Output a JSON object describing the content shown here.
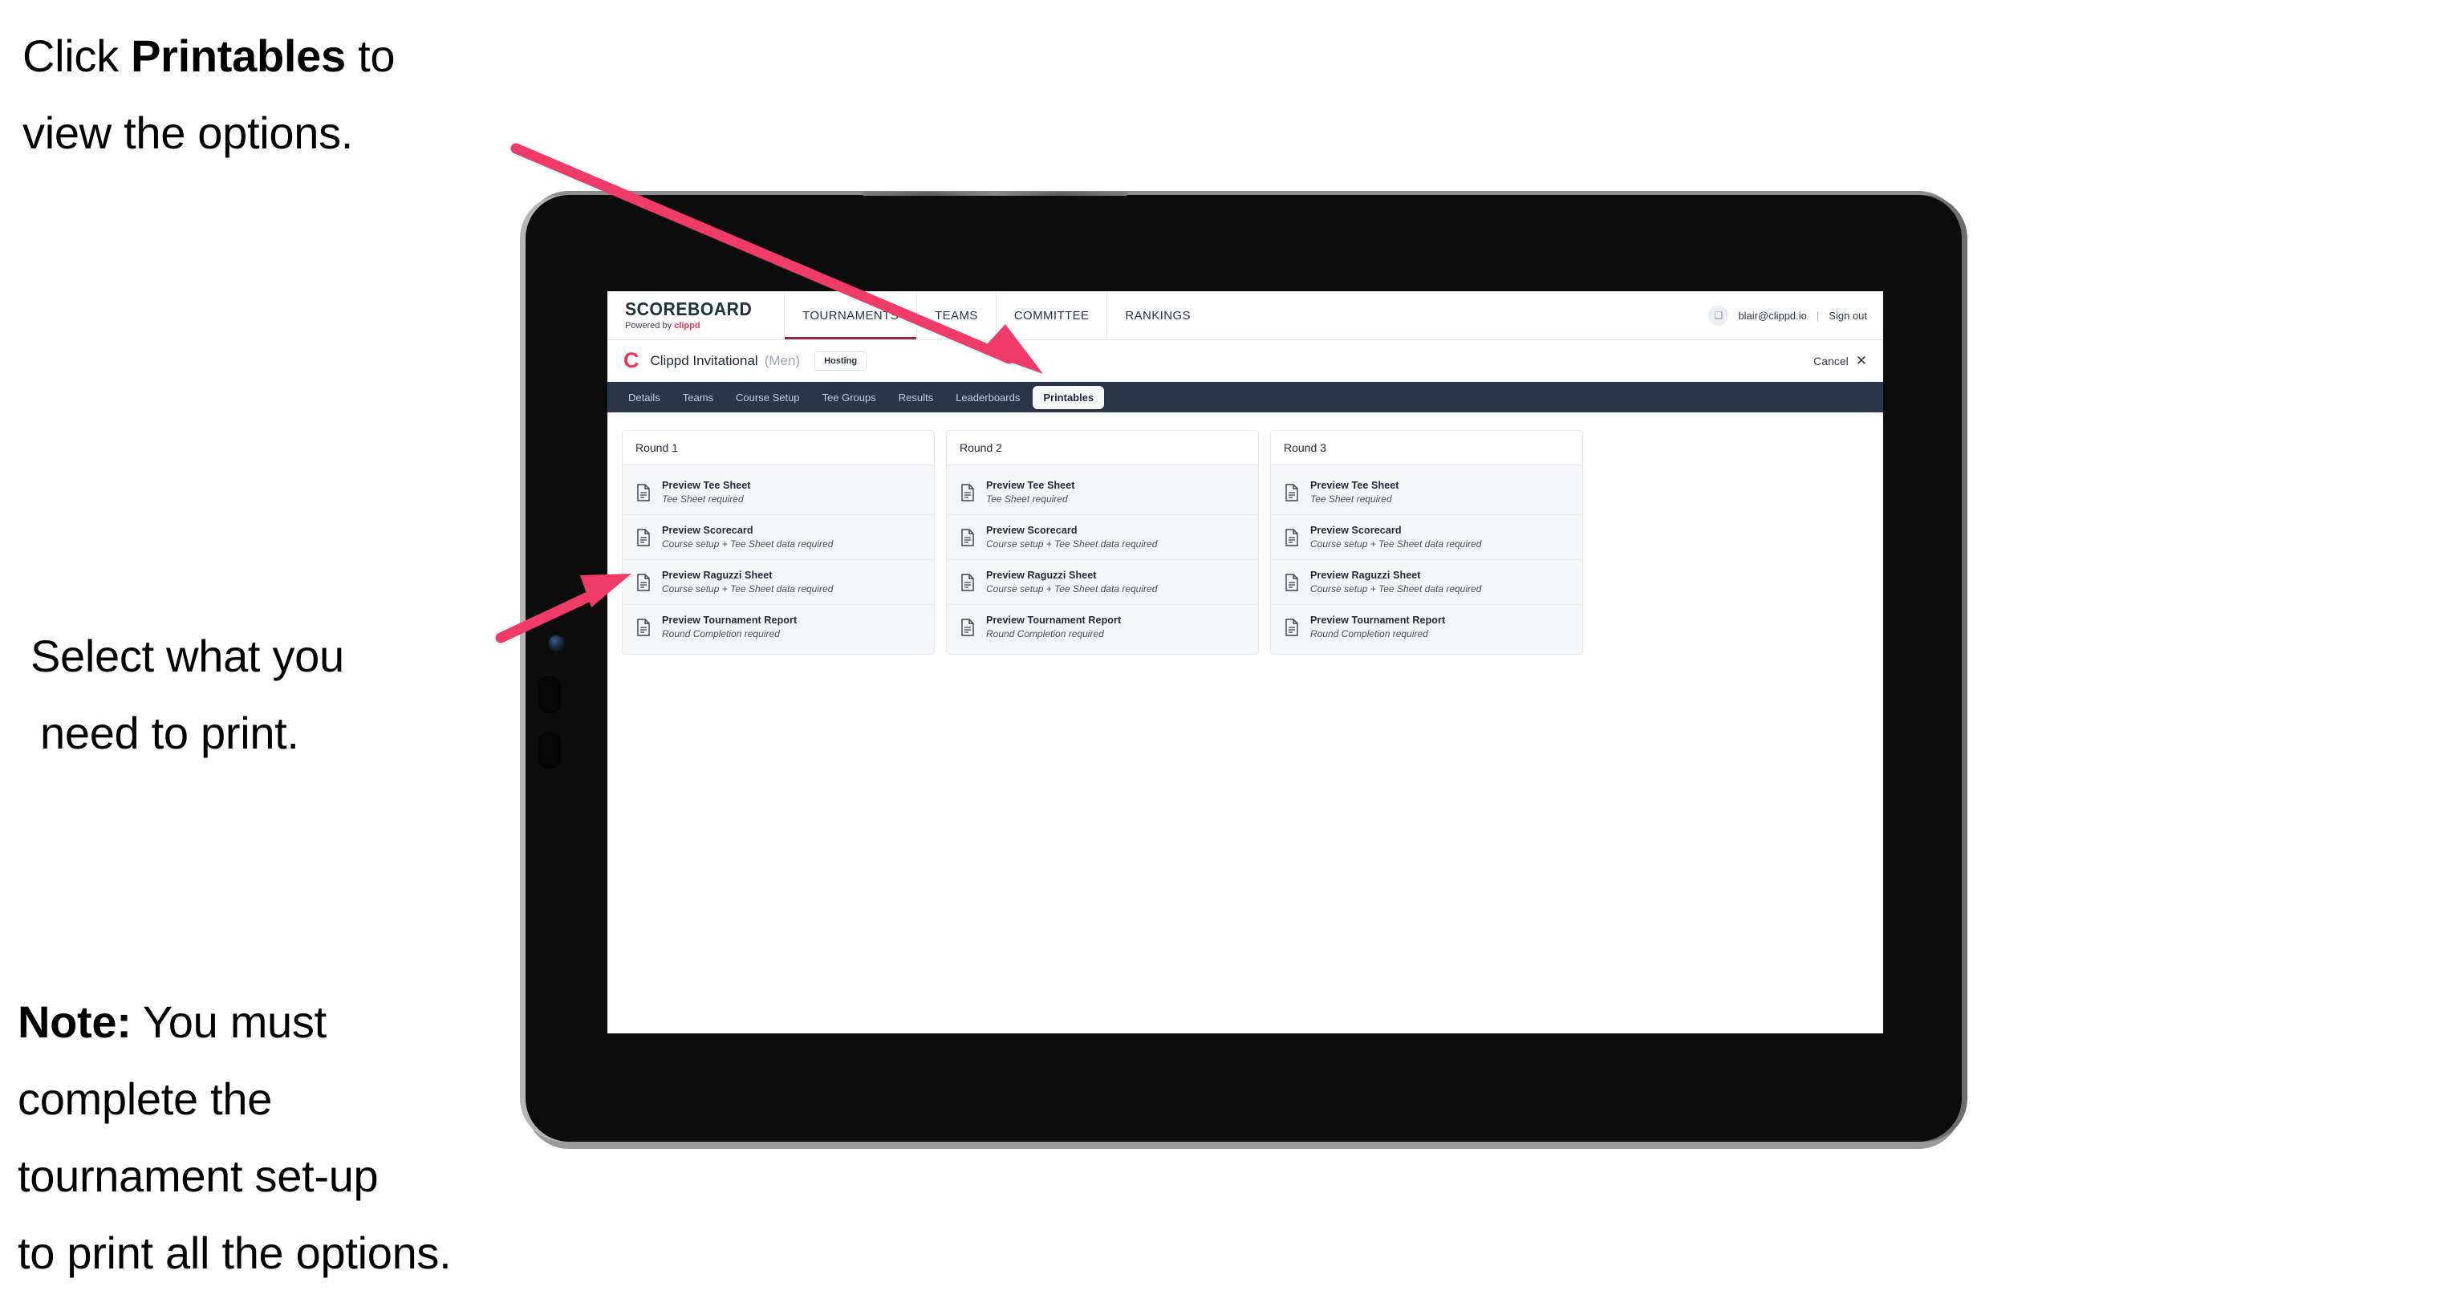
{
  "annotations": {
    "click_printables": {
      "line1_pre": "Click ",
      "line1_bold": "Printables",
      "line1_post": " to",
      "line2": "view the options."
    },
    "select_print": {
      "line1": "Select what you",
      "line2": "need to print."
    },
    "note": {
      "bold": "Note:",
      "line1_rest": " You must",
      "line2": "complete the",
      "line3": "tournament set-up",
      "line4": "to print all the options."
    },
    "arrow_color": "#ef3b68"
  },
  "app": {
    "brand": {
      "name": "SCOREBOARD",
      "powered_prefix": "Powered by ",
      "powered_brand": "clippd"
    },
    "topnav": [
      {
        "label": "TOURNAMENTS",
        "active": true
      },
      {
        "label": "TEAMS",
        "active": false
      },
      {
        "label": "COMMITTEE",
        "active": false
      },
      {
        "label": "RANKINGS",
        "active": false
      }
    ],
    "account": {
      "avatar_glyph": "❑",
      "email": "blair@clippd.io",
      "separator": "|",
      "sign_out": "Sign out"
    },
    "tournament_bar": {
      "logo_letter": "C",
      "title": "Clippd Invitational",
      "gender": "(Men)",
      "badge": "Hosting",
      "cancel_label": "Cancel",
      "cancel_icon": "✕"
    },
    "section_nav": [
      {
        "label": "Details",
        "active": false
      },
      {
        "label": "Teams",
        "active": false
      },
      {
        "label": "Course Setup",
        "active": false
      },
      {
        "label": "Tee Groups",
        "active": false
      },
      {
        "label": "Results",
        "active": false
      },
      {
        "label": "Leaderboards",
        "active": false
      },
      {
        "label": "Printables",
        "active": true
      }
    ],
    "printables": {
      "rounds": [
        {
          "heading": "Round 1",
          "items": [
            {
              "title": "Preview Tee Sheet",
              "requirement": "Tee Sheet required"
            },
            {
              "title": "Preview Scorecard",
              "requirement": "Course setup + Tee Sheet data required"
            },
            {
              "title": "Preview Raguzzi Sheet",
              "requirement": "Course setup + Tee Sheet data required"
            },
            {
              "title": "Preview Tournament Report",
              "requirement": "Round Completion required"
            }
          ]
        },
        {
          "heading": "Round 2",
          "items": [
            {
              "title": "Preview Tee Sheet",
              "requirement": "Tee Sheet required"
            },
            {
              "title": "Preview Scorecard",
              "requirement": "Course setup + Tee Sheet data required"
            },
            {
              "title": "Preview Raguzzi Sheet",
              "requirement": "Course setup + Tee Sheet data required"
            },
            {
              "title": "Preview Tournament Report",
              "requirement": "Round Completion required"
            }
          ]
        },
        {
          "heading": "Round 3",
          "items": [
            {
              "title": "Preview Tee Sheet",
              "requirement": "Tee Sheet required"
            },
            {
              "title": "Preview Scorecard",
              "requirement": "Course setup + Tee Sheet data required"
            },
            {
              "title": "Preview Raguzzi Sheet",
              "requirement": "Course setup + Tee Sheet data required"
            },
            {
              "title": "Preview Tournament Report",
              "requirement": "Round Completion required"
            }
          ]
        }
      ]
    }
  },
  "colors": {
    "accent_pink": "#e8345d",
    "navbar_dark": "#2a3547",
    "arrow_pink": "#ef3b68",
    "text_dark": "#222a35"
  }
}
